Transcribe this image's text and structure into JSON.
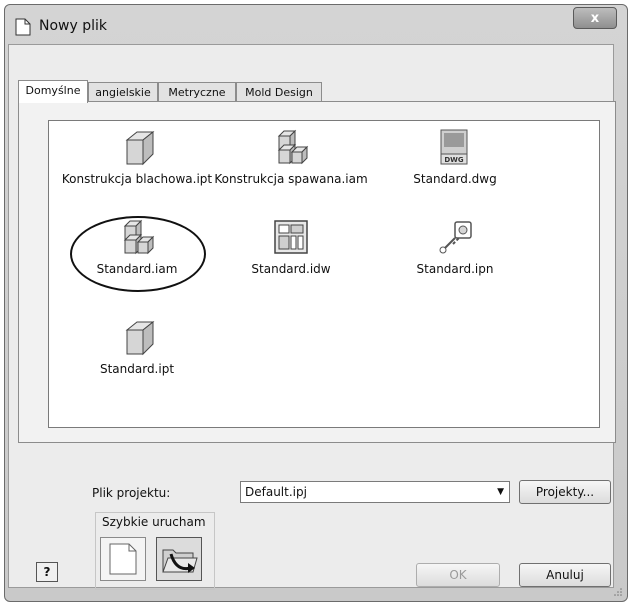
{
  "window": {
    "title": "Nowy plik",
    "close_label": "x"
  },
  "tabs": [
    {
      "label": "Domyślne",
      "active": true
    },
    {
      "label": "angielskie",
      "active": false
    },
    {
      "label": "Metryczne",
      "active": false
    },
    {
      "label": "Mold Design",
      "active": false
    }
  ],
  "files": [
    {
      "label": "Konstrukcja blachowa.ipt",
      "icon": "part-icon"
    },
    {
      "label": "Konstrukcja spawana.iam",
      "icon": "assembly-icon"
    },
    {
      "label": "Standard.dwg",
      "icon": "dwg-drawing-icon",
      "icon_text": "DWG"
    },
    {
      "label": "Standard.iam",
      "icon": "assembly-icon",
      "highlighted": true
    },
    {
      "label": "Standard.idw",
      "icon": "idw-drawing-icon"
    },
    {
      "label": "Standard.ipn",
      "icon": "presentation-icon"
    },
    {
      "label": "Standard.ipt",
      "icon": "part-icon"
    }
  ],
  "project": {
    "label": "Plik projektu:",
    "value": "Default.ipj",
    "button": "Projekty..."
  },
  "quick_launch": {
    "title": "Szybkie urucham"
  },
  "buttons": {
    "ok": "OK",
    "cancel": "Anuluj",
    "help": "?"
  }
}
